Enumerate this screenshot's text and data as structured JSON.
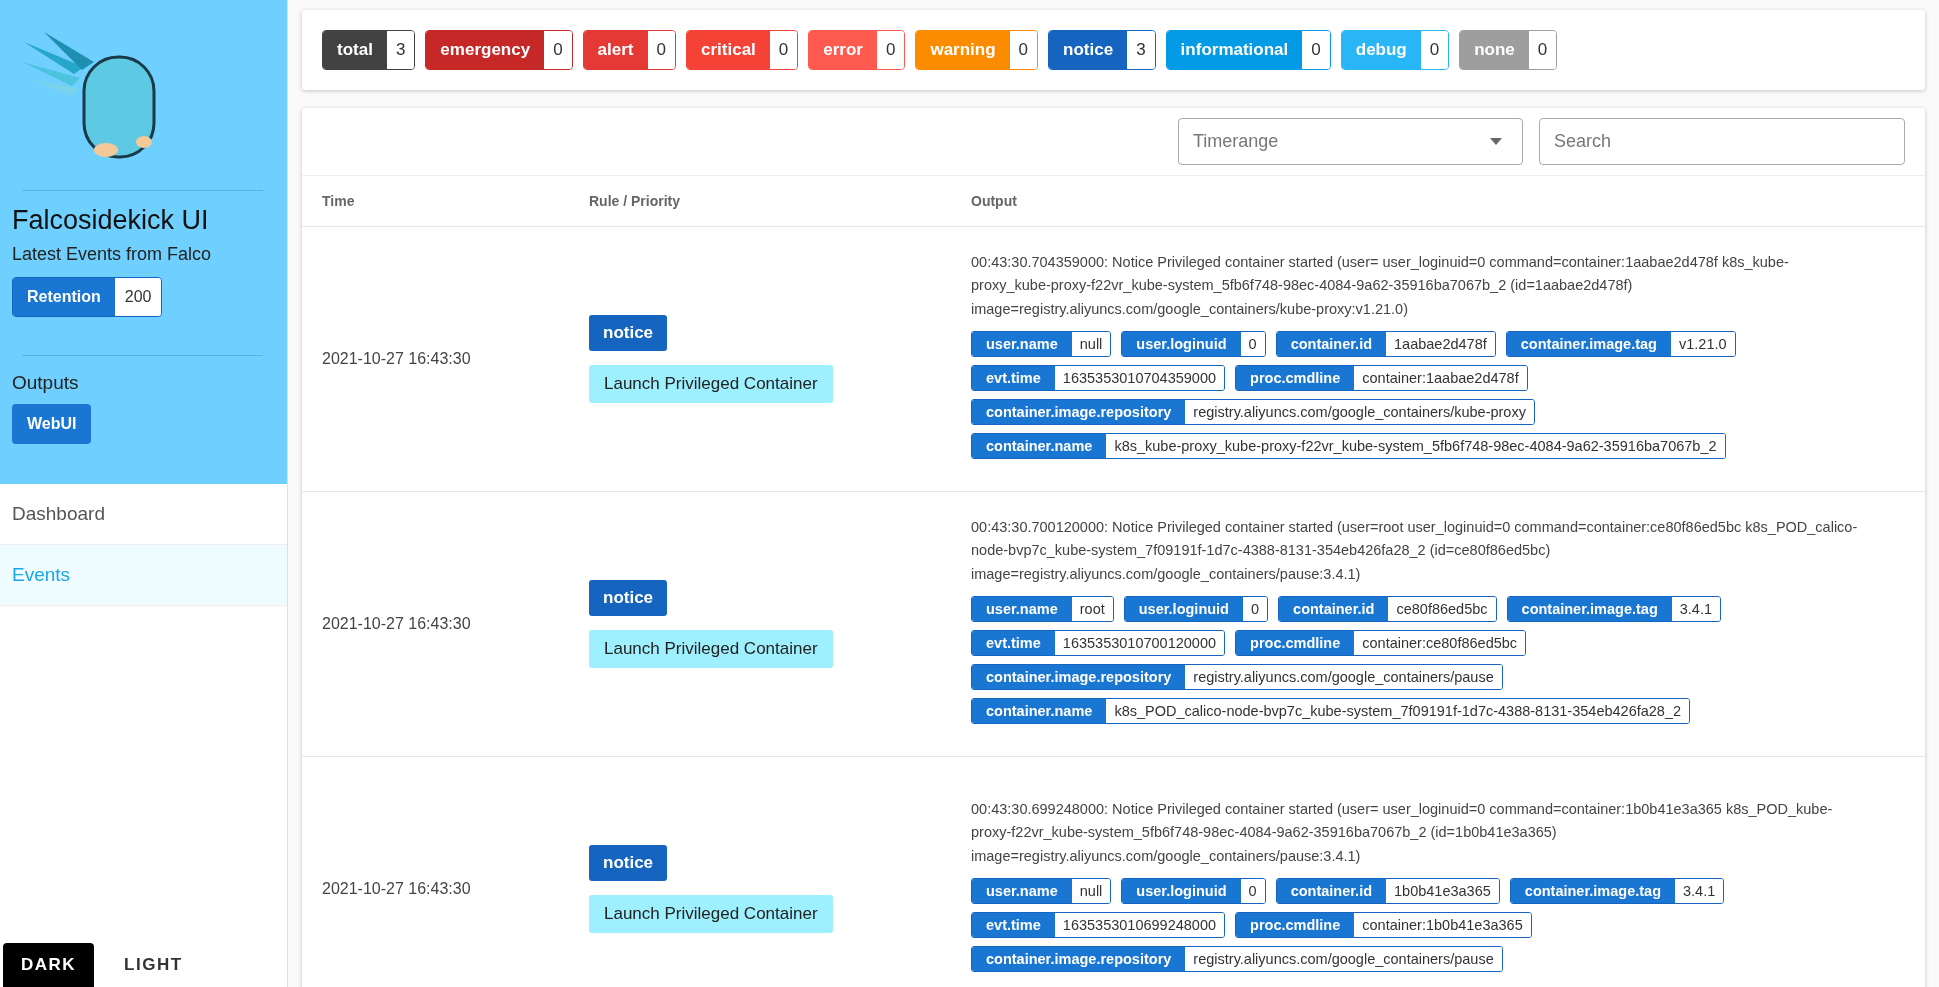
{
  "sidebar": {
    "title": "Falcosidekick UI",
    "subtitle": "Latest Events from Falco",
    "retention": {
      "label": "Retention",
      "value": "200"
    },
    "outputs_heading": "Outputs",
    "outputs": [
      "WebUI"
    ],
    "nav": [
      {
        "label": "Dashboard",
        "selected": false
      },
      {
        "label": "Events",
        "selected": true
      }
    ],
    "theme": [
      {
        "label": "DARK",
        "selected": true
      },
      {
        "label": "LIGHT",
        "selected": false
      }
    ]
  },
  "counters": [
    {
      "label": "total",
      "count": "3",
      "color": "#424242"
    },
    {
      "label": "emergency",
      "count": "0",
      "color": "#c62828"
    },
    {
      "label": "alert",
      "count": "0",
      "color": "#e53935"
    },
    {
      "label": "critical",
      "count": "0",
      "color": "#f44336"
    },
    {
      "label": "error",
      "count": "0",
      "color": "#ff5a4f"
    },
    {
      "label": "warning",
      "count": "0",
      "color": "#fb8c00"
    },
    {
      "label": "notice",
      "count": "3",
      "color": "#1565c0"
    },
    {
      "label": "informational",
      "count": "0",
      "color": "#039be5"
    },
    {
      "label": "debug",
      "count": "0",
      "color": "#29b6f6"
    },
    {
      "label": "none",
      "count": "0",
      "color": "#9e9e9e"
    }
  ],
  "filters": {
    "timerange": {
      "placeholder": "Timerange"
    },
    "search": {
      "placeholder": "Search"
    }
  },
  "table": {
    "columns": [
      "Time",
      "Rule / Priority",
      "Output"
    ],
    "rows": [
      {
        "time": "2021-10-27 16:43:30",
        "priority": "notice",
        "rule": "Launch Privileged Container",
        "output": "00:43:30.704359000: Notice Privileged container started (user= user_loginuid=0 command=container:1aabae2d478f k8s_kube-proxy_kube-proxy-f22vr_kube-system_5fb6f748-98ec-4084-9a62-35916ba7067b_2 (id=1aabae2d478f) image=registry.aliyuncs.com/google_containers/kube-proxy:v1.21.0)",
        "field_lines": [
          [
            {
              "key": "user.name",
              "value": "null"
            },
            {
              "key": "user.loginuid",
              "value": "0"
            },
            {
              "key": "container.id",
              "value": "1aabae2d478f"
            },
            {
              "key": "container.image.tag",
              "value": "v1.21.0"
            }
          ],
          [
            {
              "key": "evt.time",
              "value": "1635353010704359000"
            },
            {
              "key": "proc.cmdline",
              "value": "container:1aabae2d478f"
            }
          ],
          [
            {
              "key": "container.image.repository",
              "value": "registry.aliyuncs.com/google_containers/kube-proxy"
            }
          ],
          [
            {
              "key": "container.name",
              "value": "k8s_kube-proxy_kube-proxy-f22vr_kube-system_5fb6f748-98ec-4084-9a62-35916ba7067b_2"
            }
          ]
        ]
      },
      {
        "time": "2021-10-27 16:43:30",
        "priority": "notice",
        "rule": "Launch Privileged Container",
        "output": "00:43:30.700120000: Notice Privileged container started (user=root user_loginuid=0 command=container:ce80f86ed5bc k8s_POD_calico-node-bvp7c_kube-system_7f09191f-1d7c-4388-8131-354eb426fa28_2 (id=ce80f86ed5bc) image=registry.aliyuncs.com/google_containers/pause:3.4.1)",
        "field_lines": [
          [
            {
              "key": "user.name",
              "value": "root"
            },
            {
              "key": "user.loginuid",
              "value": "0"
            },
            {
              "key": "container.id",
              "value": "ce80f86ed5bc"
            },
            {
              "key": "container.image.tag",
              "value": "3.4.1"
            }
          ],
          [
            {
              "key": "evt.time",
              "value": "1635353010700120000"
            },
            {
              "key": "proc.cmdline",
              "value": "container:ce80f86ed5bc"
            }
          ],
          [
            {
              "key": "container.image.repository",
              "value": "registry.aliyuncs.com/google_containers/pause"
            }
          ],
          [
            {
              "key": "container.name",
              "value": "k8s_POD_calico-node-bvp7c_kube-system_7f09191f-1d7c-4388-8131-354eb426fa28_2"
            }
          ]
        ]
      },
      {
        "time": "2021-10-27 16:43:30",
        "priority": "notice",
        "rule": "Launch Privileged Container",
        "output": "00:43:30.699248000: Notice Privileged container started (user= user_loginuid=0 command=container:1b0b41e3a365 k8s_POD_kube-proxy-f22vr_kube-system_5fb6f748-98ec-4084-9a62-35916ba7067b_2 (id=1b0b41e3a365) image=registry.aliyuncs.com/google_containers/pause:3.4.1)",
        "field_lines": [
          [
            {
              "key": "user.name",
              "value": "null"
            },
            {
              "key": "user.loginuid",
              "value": "0"
            },
            {
              "key": "container.id",
              "value": "1b0b41e3a365"
            },
            {
              "key": "container.image.tag",
              "value": "3.4.1"
            }
          ],
          [
            {
              "key": "evt.time",
              "value": "1635353010699248000"
            },
            {
              "key": "proc.cmdline",
              "value": "container:1b0b41e3a365"
            }
          ],
          [
            {
              "key": "container.image.repository",
              "value": "registry.aliyuncs.com/google_containers/pause"
            }
          ]
        ]
      }
    ]
  }
}
